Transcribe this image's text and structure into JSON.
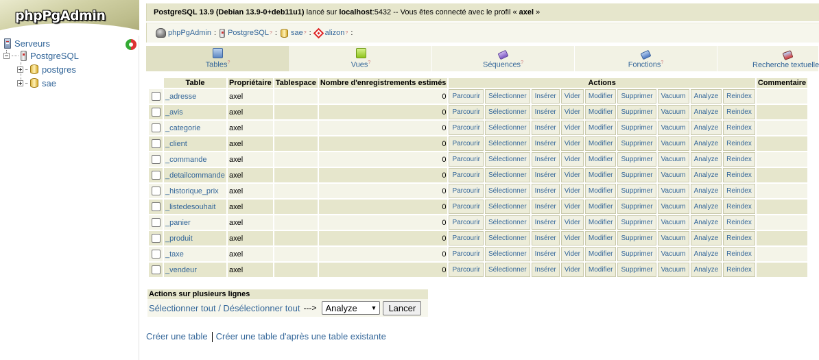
{
  "sidebar": {
    "logo": "phpPgAdmin",
    "tree": {
      "servers": "Serveurs",
      "server": "PostgreSQL",
      "databases": [
        "postgres",
        "sae"
      ]
    }
  },
  "topbar": {
    "server_version": "PostgreSQL 13.9 (Debian 13.9-0+deb11u1)",
    "on_text": " lancé sur ",
    "host": "localhost",
    "port": ":5432",
    "connected_text": " -- Vous êtes connecté avec le profil « ",
    "user": "axel",
    "end_text": " »"
  },
  "trail": {
    "items": [
      "phpPgAdmin",
      "PostgreSQL",
      "sae",
      "alizon"
    ],
    "help_mark": "?",
    "separator": ":"
  },
  "tabs": [
    {
      "label": "Tables",
      "icon": "tables-icon"
    },
    {
      "label": "Vues",
      "icon": "views-icon"
    },
    {
      "label": "Séquences",
      "icon": "sequences-icon"
    },
    {
      "label": "Fonctions",
      "icon": "functions-icon"
    },
    {
      "label": "Recherche textuelle",
      "icon": "fulltext-search-icon"
    }
  ],
  "table": {
    "headers": {
      "table": "Table",
      "owner": "Propriétaire",
      "tablespace": "Tablespace",
      "rows": "Nombre d'enregistrements estimés",
      "actions": "Actions",
      "comment": "Commentaire"
    },
    "actions": [
      "Parcourir",
      "Sélectionner",
      "Insérer",
      "Vider",
      "Modifier",
      "Supprimer",
      "Vacuum",
      "Analyze",
      "Reindex"
    ],
    "rows": [
      {
        "name": "_adresse",
        "owner": "axel",
        "tablespace": "",
        "count": "0",
        "comment": ""
      },
      {
        "name": "_avis",
        "owner": "axel",
        "tablespace": "",
        "count": "0",
        "comment": ""
      },
      {
        "name": "_categorie",
        "owner": "axel",
        "tablespace": "",
        "count": "0",
        "comment": ""
      },
      {
        "name": "_client",
        "owner": "axel",
        "tablespace": "",
        "count": "0",
        "comment": ""
      },
      {
        "name": "_commande",
        "owner": "axel",
        "tablespace": "",
        "count": "0",
        "comment": ""
      },
      {
        "name": "_detailcommande",
        "owner": "axel",
        "tablespace": "",
        "count": "0",
        "comment": ""
      },
      {
        "name": "_historique_prix",
        "owner": "axel",
        "tablespace": "",
        "count": "0",
        "comment": ""
      },
      {
        "name": "_listedesouhait",
        "owner": "axel",
        "tablespace": "",
        "count": "0",
        "comment": ""
      },
      {
        "name": "_panier",
        "owner": "axel",
        "tablespace": "",
        "count": "0",
        "comment": ""
      },
      {
        "name": "_produit",
        "owner": "axel",
        "tablespace": "",
        "count": "0",
        "comment": ""
      },
      {
        "name": "_taxe",
        "owner": "axel",
        "tablespace": "",
        "count": "0",
        "comment": ""
      },
      {
        "name": "_vendeur",
        "owner": "axel",
        "tablespace": "",
        "count": "0",
        "comment": ""
      }
    ]
  },
  "multi": {
    "title": "Actions sur plusieurs lignes",
    "select_all": "Sélectionner tout",
    "slash": " / ",
    "deselect_all": "Désélectionner tout",
    "arrow": "--->",
    "selected_action": "Analyze",
    "submit": "Lancer"
  },
  "links": {
    "create_table": "Créer une table",
    "create_like": "Créer une table d'après une table existante"
  }
}
